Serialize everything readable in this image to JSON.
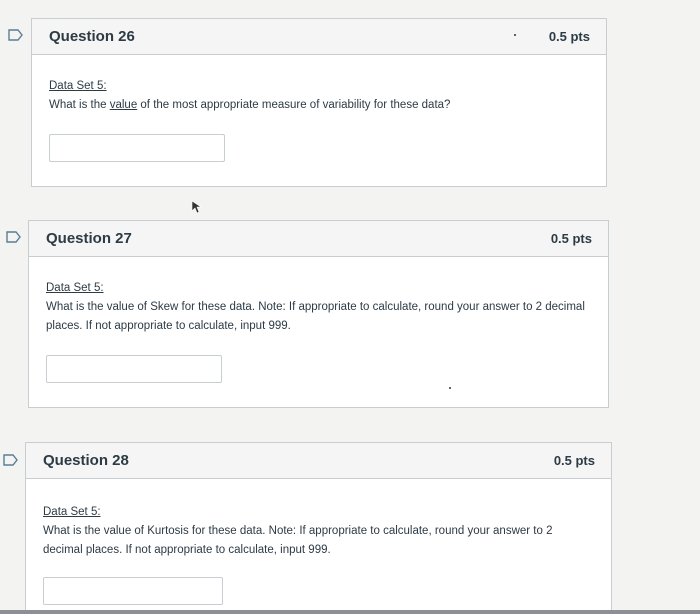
{
  "questions": [
    {
      "title": "Question 26",
      "points": "0.5 pts",
      "data_set": "Data Set 5:",
      "prompt_before": "What is the ",
      "prompt_underlined": "value",
      "prompt_after": " of the most appropriate measure of variability for these data?",
      "answer_value": ""
    },
    {
      "title": "Question 27",
      "points": "0.5 pts",
      "data_set": "Data Set 5:",
      "prompt": "What is the value of Skew for these data.  Note: If appropriate to calculate, round your answer to 2 decimal places.  If not appropriate to calculate, input 999.",
      "answer_value": ""
    },
    {
      "title": "Question 28",
      "points": "0.5 pts",
      "data_set": "Data Set 5:",
      "prompt": "What is the value of Kurtosis for these data.  Note: If appropriate to calculate, round your answer to 2 decimal places.  If not appropriate to calculate, input 999.",
      "answer_value": ""
    }
  ],
  "icons": {
    "flag": "flag-icon",
    "cursor": "mouse-cursor-icon"
  },
  "colors": {
    "flag_stroke": "#5b7e96",
    "header_bg": "#f5f5f5",
    "border": "#c7cdd1",
    "text": "#2d3b45"
  }
}
